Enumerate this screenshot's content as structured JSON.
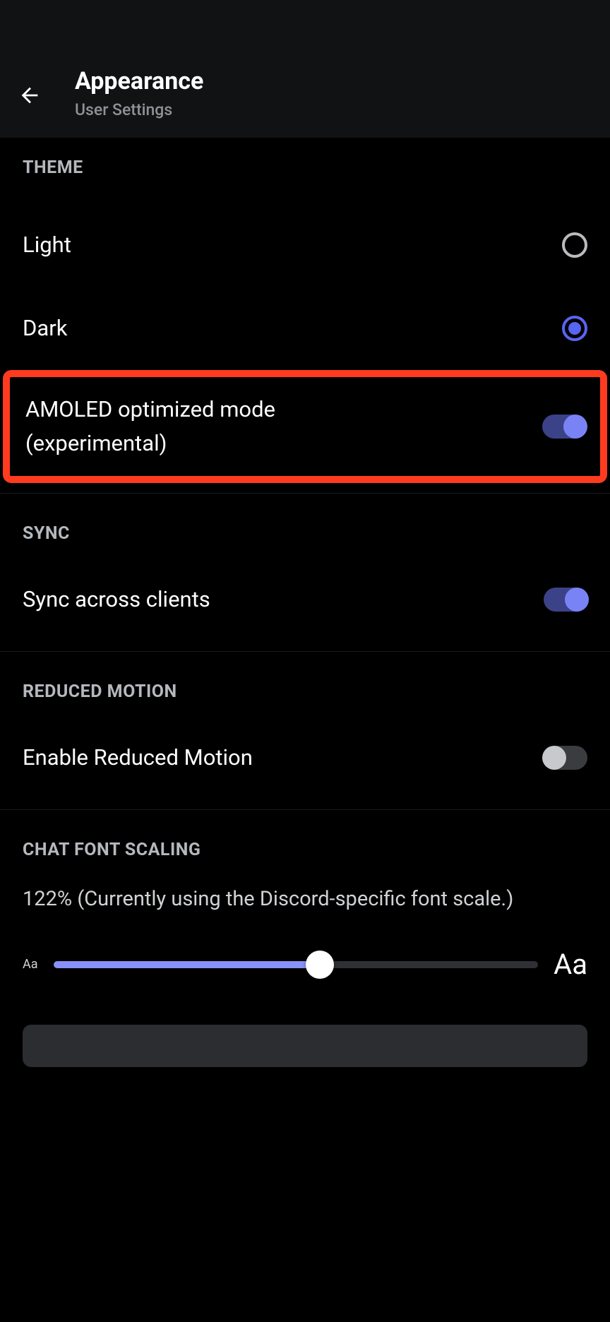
{
  "header": {
    "title": "Appearance",
    "subtitle": "User Settings"
  },
  "theme": {
    "section_label": "THEME",
    "light_label": "Light",
    "dark_label": "Dark",
    "amoled_label": "AMOLED optimized mode (experimental)",
    "selected": "dark",
    "amoled_on": true
  },
  "sync": {
    "section_label": "SYNC",
    "sync_clients_label": "Sync across clients",
    "sync_clients_on": true
  },
  "reduced_motion": {
    "section_label": "REDUCED MOTION",
    "enable_label": "Enable Reduced Motion",
    "enable_on": false
  },
  "font_scaling": {
    "section_label": "CHAT FONT SCALING",
    "description": "122% (Currently using the Discord-specific font scale.)",
    "min_glyph": "Aa",
    "max_glyph": "Aa",
    "value_percent": 55
  }
}
